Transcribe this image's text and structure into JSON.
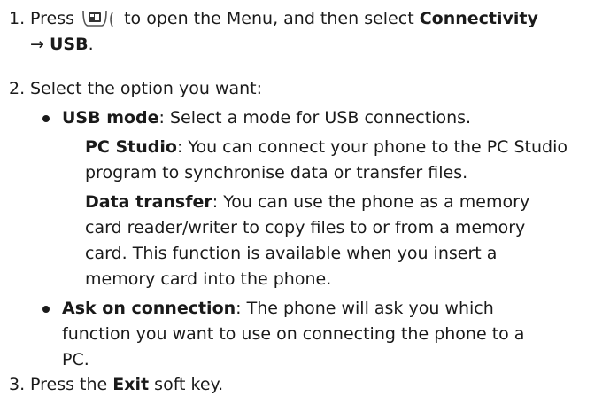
{
  "steps": [
    {
      "number": "1.",
      "pre": "Press",
      "icon": "menu-soft-key-icon",
      "mid": "to open the Menu, and then select",
      "bold1": "Connectivity",
      "arrow": "→",
      "bold2": "USB",
      "post": "."
    },
    {
      "number": "2.",
      "text": "Select the option you want:"
    },
    {
      "number": "3.",
      "pre": "Press the",
      "bold": "Exit",
      "post": "soft key."
    }
  ],
  "options": [
    {
      "title": "USB mode",
      "desc": ": Select a mode for USB connections.",
      "sub": [
        {
          "title": "PC Studio",
          "lines": [
            ": You can connect your phone to the PC Studio",
            "program to synchronise data or transfer files."
          ]
        },
        {
          "title": "Data transfer",
          "lines": [
            ": You can use the phone as a memory",
            "card reader/writer to copy files to or from a memory",
            "card. This function is available when you insert a",
            "memory card into the phone."
          ]
        }
      ]
    },
    {
      "title": "Ask on connection",
      "lines": [
        ": The phone will ask you which",
        "function you want to use on connecting the phone to a",
        "PC."
      ]
    }
  ]
}
